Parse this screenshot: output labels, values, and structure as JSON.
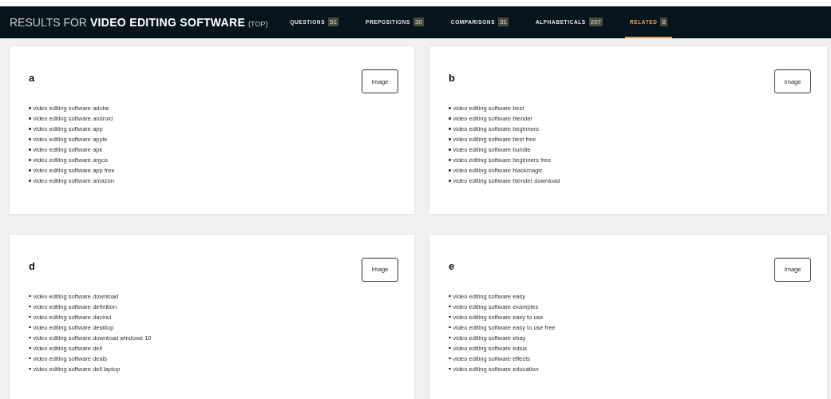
{
  "header": {
    "prefix": "RESULTS FOR",
    "query": "VIDEO EDITING SOFTWARE",
    "suffix": "(TOP)"
  },
  "tabs": [
    {
      "label": "QUESTIONS",
      "count": "51",
      "selected": false
    },
    {
      "label": "PREPOSITIONS",
      "count": "30",
      "selected": false
    },
    {
      "label": "COMPARISONS",
      "count": "31",
      "selected": false
    },
    {
      "label": "ALPHABETICALS",
      "count": "207",
      "selected": false
    },
    {
      "label": "RELATED",
      "count": "8",
      "selected": true
    }
  ],
  "cards": [
    {
      "letter": "a",
      "button": "Image",
      "items": [
        "video editing software adobe",
        "video editing software android",
        "video editing software app",
        "video editing software apple",
        "video editing software apk",
        "video editing software argos",
        "video editing software app free",
        "video editing software amazon"
      ]
    },
    {
      "letter": "b",
      "button": "Image",
      "items": [
        "video editing software best",
        "video editing software blender",
        "video editing software beginners",
        "video editing software best free",
        "video editing software bundle",
        "video editing software beginners free",
        "video editing software blackmagic",
        "video editing software blender download"
      ]
    },
    {
      "letter": "d",
      "button": "Image",
      "items": [
        "video editing software download",
        "video editing software definition",
        "video editing software davinci",
        "video editing software desktop",
        "video editing software download windows 10",
        "video editing software dell",
        "video editing software deals",
        "video editing software dell laptop"
      ]
    },
    {
      "letter": "e",
      "button": "Image",
      "items": [
        "video editing software easy",
        "video editing software examples",
        "video editing software easy to use",
        "video editing software easy to use free",
        "video editing software ebay",
        "video editing software edius",
        "video editing software effects",
        "video editing software education"
      ]
    }
  ]
}
